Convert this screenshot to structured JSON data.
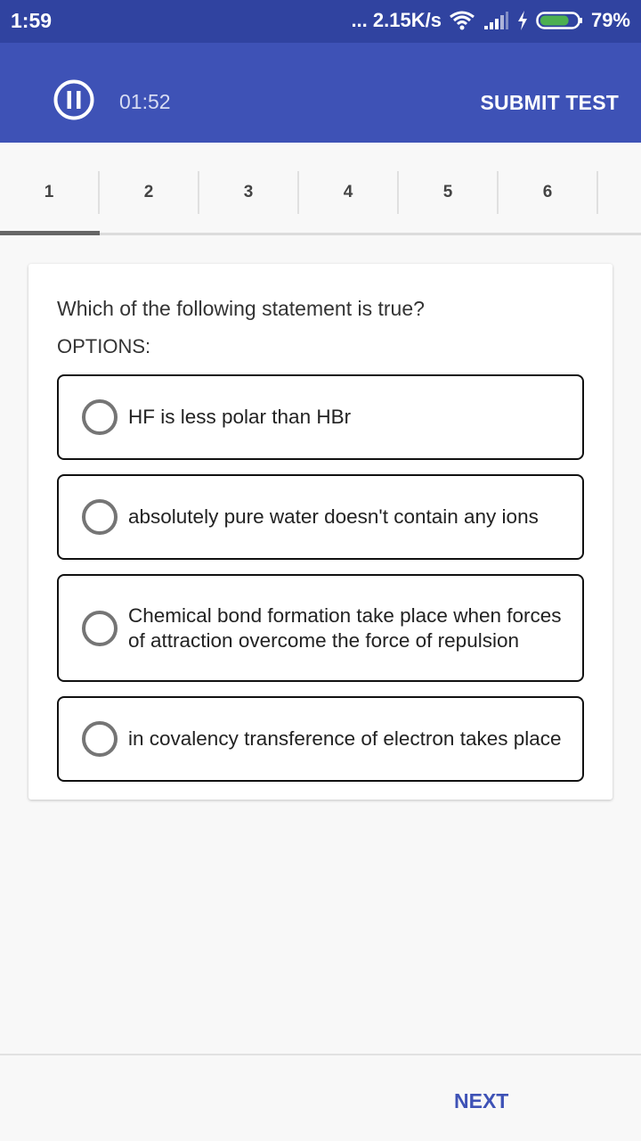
{
  "status_bar": {
    "time": "1:59",
    "network_speed": "... 2.15K/s",
    "battery_percent": "79%",
    "battery_level": 0.79
  },
  "app_bar": {
    "timer": "01:52",
    "submit_label": "SUBMIT TEST"
  },
  "tabs": [
    {
      "label": "1",
      "selected": true
    },
    {
      "label": "2",
      "selected": false
    },
    {
      "label": "3",
      "selected": false
    },
    {
      "label": "4",
      "selected": false
    },
    {
      "label": "5",
      "selected": false
    },
    {
      "label": "6",
      "selected": false
    }
  ],
  "question": {
    "text": "Which of the following statement is true?",
    "options_label": "OPTIONS:",
    "options": [
      {
        "text": "HF is less polar than HBr"
      },
      {
        "text": "absolutely pure water doesn't contain any ions"
      },
      {
        "text": "Chemical bond formation take place when forces of attraction overcome the force of repulsion"
      },
      {
        "text": "in covalency transference of electron takes place"
      }
    ]
  },
  "footer": {
    "next_label": "NEXT"
  },
  "colors": {
    "status_bar": "#3043a0",
    "app_bar": "#3e52b6",
    "accent": "#3e52b6",
    "battery": "#4caf50"
  }
}
